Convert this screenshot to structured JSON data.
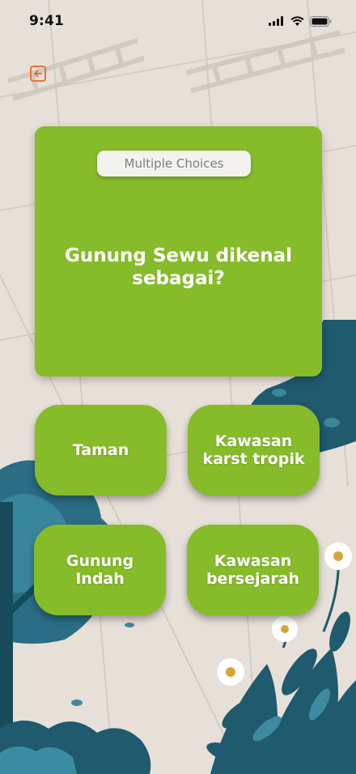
{
  "status_bar": {
    "time": "9:41"
  },
  "quiz": {
    "type_label": "Multiple Choices",
    "question": "Gunung Sewu dikenal sebagai?",
    "options": [
      "Taman",
      "Kawasan karst tropik",
      "Gunung Indah",
      "Kawasan bersejarah"
    ]
  },
  "colors": {
    "card": "#86bb2a",
    "background": "#e6e0d8",
    "back_icon": "#e8733a",
    "foliage": "#1f5a6f"
  },
  "icons": [
    "signal-icon",
    "wifi-icon",
    "battery-icon",
    "back-arrow-icon"
  ]
}
